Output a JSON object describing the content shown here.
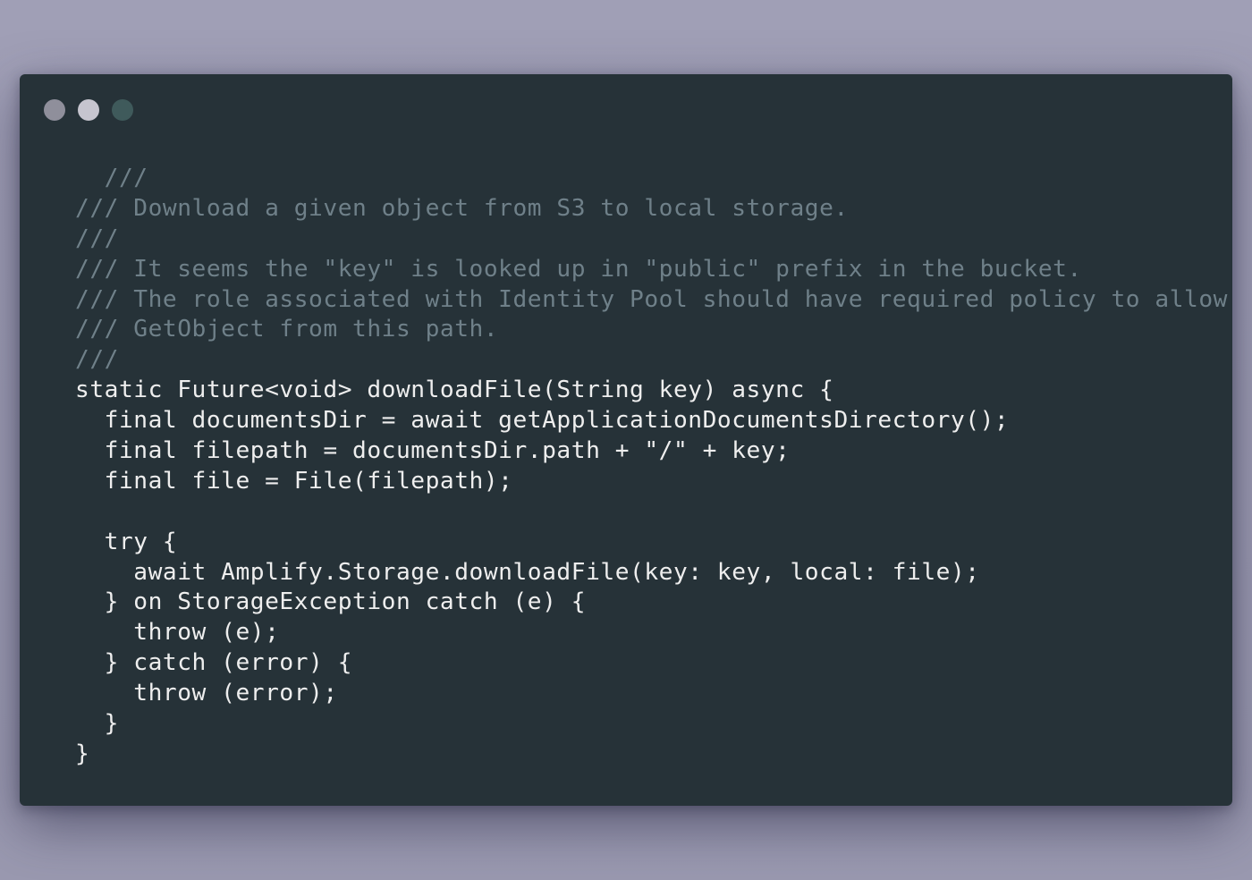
{
  "window": {
    "controls": [
      "close-dot",
      "minimize-dot",
      "maximize-dot"
    ],
    "colors": {
      "background": "#263238",
      "comment": "#6f8089",
      "text": "#eeeeee",
      "dot_close": "#8f8f9b",
      "dot_minimize": "#c6c5cf",
      "dot_maximize": "#3f5a5b"
    }
  },
  "code": {
    "language": "dart",
    "lines": [
      {
        "text": "  ///",
        "kind": "comment"
      },
      {
        "text": "/// Download a given object from S3 to local storage.",
        "kind": "comment"
      },
      {
        "text": "///",
        "kind": "comment"
      },
      {
        "text": "/// It seems the \"key\" is looked up in \"public\" prefix in the bucket.",
        "kind": "comment"
      },
      {
        "text": "/// The role associated with Identity Pool should have required policy to allow",
        "kind": "comment"
      },
      {
        "text": "/// GetObject from this path.",
        "kind": "comment"
      },
      {
        "text": "///",
        "kind": "comment"
      },
      {
        "text": "static Future<void> downloadFile(String key) async {",
        "kind": "code"
      },
      {
        "text": "  final documentsDir = await getApplicationDocumentsDirectory();",
        "kind": "code"
      },
      {
        "text": "  final filepath = documentsDir.path + \"/\" + key;",
        "kind": "code"
      },
      {
        "text": "  final file = File(filepath);",
        "kind": "code"
      },
      {
        "text": "",
        "kind": "code"
      },
      {
        "text": "  try {",
        "kind": "code"
      },
      {
        "text": "    await Amplify.Storage.downloadFile(key: key, local: file);",
        "kind": "code"
      },
      {
        "text": "  } on StorageException catch (e) {",
        "kind": "code"
      },
      {
        "text": "    throw (e);",
        "kind": "code"
      },
      {
        "text": "  } catch (error) {",
        "kind": "code"
      },
      {
        "text": "    throw (error);",
        "kind": "code"
      },
      {
        "text": "  }",
        "kind": "code"
      },
      {
        "text": "}",
        "kind": "code"
      }
    ]
  }
}
